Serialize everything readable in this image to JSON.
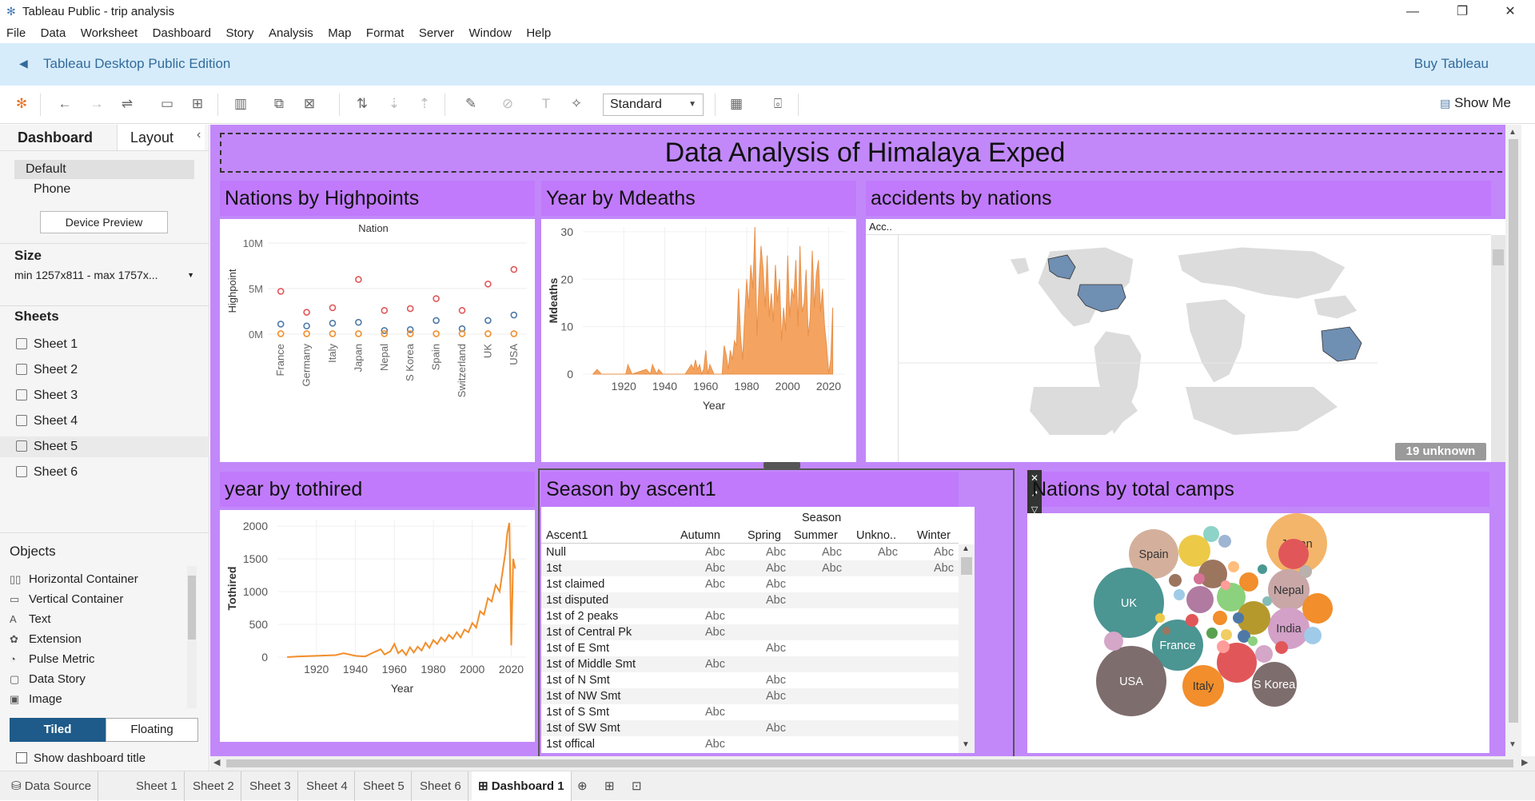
{
  "window": {
    "title": "Tableau Public - trip analysis",
    "minimize": "—",
    "restore": "❐",
    "close": "✕"
  },
  "menu": [
    "File",
    "Data",
    "Worksheet",
    "Dashboard",
    "Story",
    "Analysis",
    "Map",
    "Format",
    "Server",
    "Window",
    "Help"
  ],
  "banner": {
    "edition": "Tableau Desktop Public Edition",
    "buy": "Buy Tableau"
  },
  "toolbar": {
    "fit_select": "Standard",
    "show_me": "Show Me"
  },
  "left_panel": {
    "tab_dashboard": "Dashboard",
    "tab_layout": "Layout",
    "collapse": "‹",
    "device_default": "Default",
    "device_phone": "Phone",
    "device_preview": "Device Preview",
    "size_heading": "Size",
    "size_value": "min 1257x811 - max 1757x...",
    "sheets_heading": "Sheets",
    "sheets": [
      "Sheet 1",
      "Sheet 2",
      "Sheet 3",
      "Sheet 4",
      "Sheet 5",
      "Sheet 6"
    ],
    "objects_heading": "Objects",
    "objects": [
      {
        "icon": "horizontal-container-icon",
        "glyph": "▯▯",
        "label": "Horizontal Container"
      },
      {
        "icon": "vertical-container-icon",
        "glyph": "▭",
        "label": "Vertical Container"
      },
      {
        "icon": "text-icon",
        "glyph": "A",
        "label": "Text"
      },
      {
        "icon": "extension-icon",
        "glyph": "✿",
        "label": "Extension"
      },
      {
        "icon": "pulse-metric-icon",
        "glyph": "◔",
        "label": "Pulse Metric"
      },
      {
        "icon": "data-story-icon",
        "glyph": "▢",
        "label": "Data Story"
      },
      {
        "icon": "image-icon",
        "glyph": "▣",
        "label": "Image"
      }
    ],
    "tiled": "Tiled",
    "floating": "Floating",
    "show_title": "Show dashboard title"
  },
  "dashboard": {
    "title": "Data Analysis of Himalaya Exped",
    "sheet_titles": {
      "s1": "Nations by Highpoints",
      "s2": "Year by Mdeaths",
      "s3": "accidents by nations",
      "s4": "year by tothired",
      "s5": "Season by ascent1",
      "s6": "Nations by total camps"
    },
    "map": {
      "legend_label": "Acc..",
      "unknown_badge": "19 unknown"
    },
    "season_table": {
      "header_top": "Season",
      "row_header": "Ascent1",
      "columns": [
        "Autumn",
        "Spring",
        "Summer",
        "Unkno..",
        "Winter"
      ],
      "cell_text": "Abc",
      "rows": [
        {
          "name": "Null",
          "cells": [
            1,
            1,
            1,
            1,
            1
          ]
        },
        {
          "name": "1st",
          "cells": [
            1,
            1,
            1,
            0,
            1
          ]
        },
        {
          "name": "1st claimed",
          "cells": [
            1,
            1,
            0,
            0,
            0
          ]
        },
        {
          "name": "1st disputed",
          "cells": [
            0,
            1,
            0,
            0,
            0
          ]
        },
        {
          "name": "1st of 2 peaks",
          "cells": [
            1,
            0,
            0,
            0,
            0
          ]
        },
        {
          "name": "1st of Central Pk",
          "cells": [
            1,
            0,
            0,
            0,
            0
          ]
        },
        {
          "name": "1st of E Smt",
          "cells": [
            0,
            1,
            0,
            0,
            0
          ]
        },
        {
          "name": "1st of Middle Smt",
          "cells": [
            1,
            0,
            0,
            0,
            0
          ]
        },
        {
          "name": "1st of N Smt",
          "cells": [
            0,
            1,
            0,
            0,
            0
          ]
        },
        {
          "name": "1st of NW Smt",
          "cells": [
            0,
            1,
            0,
            0,
            0
          ]
        },
        {
          "name": "1st of S Smt",
          "cells": [
            1,
            0,
            0,
            0,
            0
          ]
        },
        {
          "name": "1st of SW Smt",
          "cells": [
            0,
            1,
            0,
            0,
            0
          ]
        },
        {
          "name": "1st offical",
          "cells": [
            1,
            0,
            0,
            0,
            0
          ]
        }
      ]
    }
  },
  "chart_data": [
    {
      "type": "scatter",
      "id": "nations-by-highpoints",
      "title": "Nation",
      "ylabel": "Highpoint",
      "categories": [
        "France",
        "Germany",
        "Italy",
        "Japan",
        "Nepal",
        "S Korea",
        "Spain",
        "Switzerland",
        "UK",
        "USA"
      ],
      "ytick_labels": [
        "10M",
        "5M",
        "0M"
      ],
      "yticks": [
        10,
        5,
        0
      ],
      "ylim": [
        0,
        10
      ],
      "series": [
        {
          "color": "#e15759",
          "values": [
            4.7,
            2.4,
            2.9,
            6.0,
            2.6,
            2.8,
            3.9,
            2.6,
            5.5,
            7.1
          ]
        },
        {
          "color": "#4e79a7",
          "values": [
            1.1,
            0.9,
            1.2,
            1.3,
            0.4,
            0.5,
            1.5,
            0.6,
            1.5,
            2.1
          ]
        },
        {
          "color": "#f28e2b",
          "values": [
            0.05,
            0.05,
            0.05,
            0.05,
            0.05,
            0.05,
            0.05,
            0.05,
            0.05,
            0.05
          ]
        }
      ]
    },
    {
      "type": "area",
      "id": "year-by-mdeaths",
      "xlabel": "Year",
      "ylabel": "Mdeaths",
      "xticks": [
        1920,
        1940,
        1960,
        1980,
        2000,
        2020
      ],
      "yticks": [
        0,
        10,
        20,
        30
      ],
      "xlim": [
        1900,
        2028
      ],
      "ylim": [
        0,
        31
      ],
      "color": "#f4a460",
      "x": [
        1905,
        1907,
        1909,
        1921,
        1922,
        1924,
        1931,
        1933,
        1934,
        1936,
        1937,
        1939,
        1946,
        1950,
        1953,
        1954,
        1955,
        1956,
        1957,
        1958,
        1959,
        1960,
        1961,
        1962,
        1963,
        1964,
        1965,
        1966,
        1967,
        1968,
        1969,
        1970,
        1971,
        1972,
        1973,
        1974,
        1975,
        1976,
        1977,
        1978,
        1979,
        1980,
        1981,
        1982,
        1983,
        1984,
        1985,
        1986,
        1987,
        1988,
        1989,
        1990,
        1991,
        1992,
        1993,
        1994,
        1995,
        1996,
        1997,
        1998,
        1999,
        2000,
        2001,
        2002,
        2003,
        2004,
        2005,
        2006,
        2007,
        2008,
        2009,
        2010,
        2011,
        2012,
        2013,
        2014,
        2015,
        2016,
        2017,
        2018,
        2019,
        2020,
        2021,
        2022
      ],
      "y": [
        0,
        1,
        0,
        0,
        2,
        0,
        1,
        0,
        2,
        0,
        1,
        0,
        0,
        0,
        2,
        1,
        3,
        1,
        2,
        0,
        1,
        5,
        0,
        2,
        1,
        0,
        0,
        0,
        0,
        0,
        6,
        4,
        1,
        5,
        3,
        7,
        6,
        18,
        8,
        3,
        12,
        20,
        14,
        23,
        18,
        31,
        8,
        19,
        27,
        22,
        14,
        25,
        12,
        17,
        11,
        23,
        15,
        20,
        7,
        14,
        9,
        25,
        12,
        18,
        16,
        24,
        10,
        27,
        13,
        15,
        22,
        8,
        12,
        26,
        14,
        21,
        24,
        13,
        18,
        10,
        6,
        0,
        3,
        14
      ]
    },
    {
      "type": "line",
      "id": "year-by-tothired",
      "xlabel": "Year",
      "ylabel": "Tothired",
      "xticks": [
        1920,
        1940,
        1960,
        1980,
        2000,
        2020
      ],
      "yticks": [
        0,
        500,
        1000,
        1500,
        2000
      ],
      "xlim": [
        1900,
        2028
      ],
      "ylim": [
        0,
        2100
      ],
      "color": "#f28e2b",
      "x": [
        1905,
        1910,
        1920,
        1930,
        1934,
        1940,
        1945,
        1950,
        1953,
        1955,
        1958,
        1960,
        1962,
        1964,
        1966,
        1968,
        1970,
        1972,
        1974,
        1976,
        1978,
        1980,
        1982,
        1984,
        1986,
        1988,
        1990,
        1992,
        1994,
        1996,
        1998,
        2000,
        2002,
        2004,
        2006,
        2008,
        2010,
        2012,
        2014,
        2016,
        2017,
        2018,
        2019,
        2020,
        2021,
        2022
      ],
      "y": [
        0,
        10,
        20,
        30,
        60,
        20,
        10,
        80,
        120,
        40,
        90,
        200,
        60,
        110,
        30,
        150,
        70,
        160,
        100,
        220,
        140,
        260,
        200,
        300,
        240,
        340,
        280,
        380,
        300,
        420,
        380,
        520,
        450,
        700,
        650,
        900,
        850,
        1100,
        1000,
        1400,
        1600,
        1900,
        2050,
        180,
        1500,
        1350
      ]
    },
    {
      "type": "scatter",
      "id": "nations-by-total-camps",
      "title": "",
      "labeled_bubbles": [
        "Japan",
        "Spain",
        "UK",
        "Nepal",
        "India",
        "France",
        "USA",
        "Italy",
        "S Korea"
      ]
    }
  ]
}
